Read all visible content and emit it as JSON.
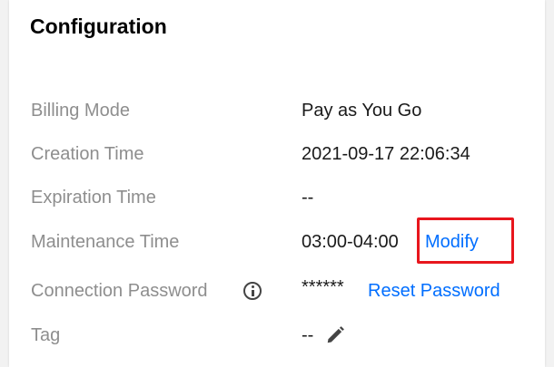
{
  "section": {
    "title": "Configuration"
  },
  "rows": {
    "billing_mode": {
      "label": "Billing Mode",
      "value": "Pay as You Go"
    },
    "creation_time": {
      "label": "Creation Time",
      "value": "2021-09-17 22:06:34"
    },
    "expiration_time": {
      "label": "Expiration Time",
      "value": "--"
    },
    "maintenance_time": {
      "label": "Maintenance Time",
      "value": "03:00-04:00",
      "action": "Modify"
    },
    "connection_password": {
      "label": "Connection Password",
      "value": "******",
      "action": "Reset Password",
      "icon": "info-icon"
    },
    "tag": {
      "label": "Tag",
      "value": "--",
      "icon": "pencil-icon"
    }
  },
  "colors": {
    "link": "#006eff",
    "highlight": "#e8161d",
    "label": "#8e8e8e",
    "value": "#1a1a1a"
  }
}
